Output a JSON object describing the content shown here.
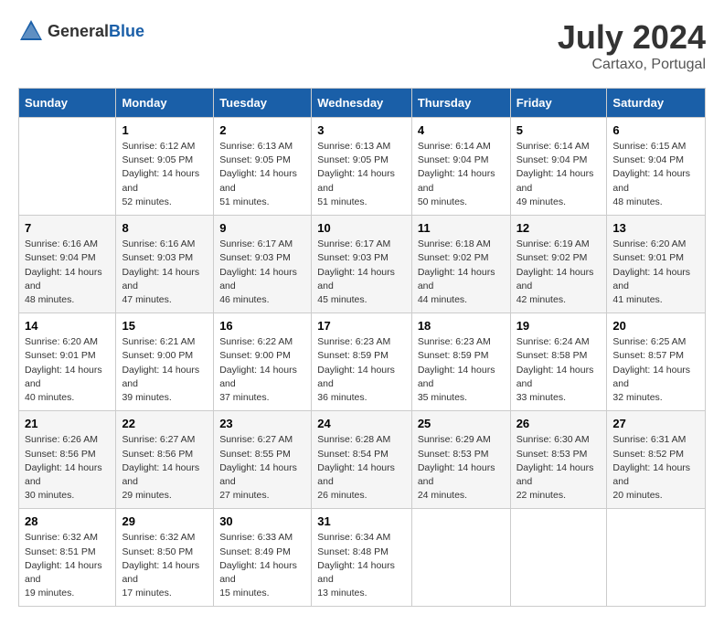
{
  "header": {
    "logo_general": "General",
    "logo_blue": "Blue",
    "month_year": "July 2024",
    "location": "Cartaxo, Portugal"
  },
  "weekdays": [
    "Sunday",
    "Monday",
    "Tuesday",
    "Wednesday",
    "Thursday",
    "Friday",
    "Saturday"
  ],
  "weeks": [
    [
      {
        "day": "",
        "sunrise": "",
        "sunset": "",
        "daylight": ""
      },
      {
        "day": "1",
        "sunrise": "Sunrise: 6:12 AM",
        "sunset": "Sunset: 9:05 PM",
        "daylight": "Daylight: 14 hours and 52 minutes."
      },
      {
        "day": "2",
        "sunrise": "Sunrise: 6:13 AM",
        "sunset": "Sunset: 9:05 PM",
        "daylight": "Daylight: 14 hours and 51 minutes."
      },
      {
        "day": "3",
        "sunrise": "Sunrise: 6:13 AM",
        "sunset": "Sunset: 9:05 PM",
        "daylight": "Daylight: 14 hours and 51 minutes."
      },
      {
        "day": "4",
        "sunrise": "Sunrise: 6:14 AM",
        "sunset": "Sunset: 9:04 PM",
        "daylight": "Daylight: 14 hours and 50 minutes."
      },
      {
        "day": "5",
        "sunrise": "Sunrise: 6:14 AM",
        "sunset": "Sunset: 9:04 PM",
        "daylight": "Daylight: 14 hours and 49 minutes."
      },
      {
        "day": "6",
        "sunrise": "Sunrise: 6:15 AM",
        "sunset": "Sunset: 9:04 PM",
        "daylight": "Daylight: 14 hours and 48 minutes."
      }
    ],
    [
      {
        "day": "7",
        "sunrise": "Sunrise: 6:16 AM",
        "sunset": "Sunset: 9:04 PM",
        "daylight": "Daylight: 14 hours and 48 minutes."
      },
      {
        "day": "8",
        "sunrise": "Sunrise: 6:16 AM",
        "sunset": "Sunset: 9:03 PM",
        "daylight": "Daylight: 14 hours and 47 minutes."
      },
      {
        "day": "9",
        "sunrise": "Sunrise: 6:17 AM",
        "sunset": "Sunset: 9:03 PM",
        "daylight": "Daylight: 14 hours and 46 minutes."
      },
      {
        "day": "10",
        "sunrise": "Sunrise: 6:17 AM",
        "sunset": "Sunset: 9:03 PM",
        "daylight": "Daylight: 14 hours and 45 minutes."
      },
      {
        "day": "11",
        "sunrise": "Sunrise: 6:18 AM",
        "sunset": "Sunset: 9:02 PM",
        "daylight": "Daylight: 14 hours and 44 minutes."
      },
      {
        "day": "12",
        "sunrise": "Sunrise: 6:19 AM",
        "sunset": "Sunset: 9:02 PM",
        "daylight": "Daylight: 14 hours and 42 minutes."
      },
      {
        "day": "13",
        "sunrise": "Sunrise: 6:20 AM",
        "sunset": "Sunset: 9:01 PM",
        "daylight": "Daylight: 14 hours and 41 minutes."
      }
    ],
    [
      {
        "day": "14",
        "sunrise": "Sunrise: 6:20 AM",
        "sunset": "Sunset: 9:01 PM",
        "daylight": "Daylight: 14 hours and 40 minutes."
      },
      {
        "day": "15",
        "sunrise": "Sunrise: 6:21 AM",
        "sunset": "Sunset: 9:00 PM",
        "daylight": "Daylight: 14 hours and 39 minutes."
      },
      {
        "day": "16",
        "sunrise": "Sunrise: 6:22 AM",
        "sunset": "Sunset: 9:00 PM",
        "daylight": "Daylight: 14 hours and 37 minutes."
      },
      {
        "day": "17",
        "sunrise": "Sunrise: 6:23 AM",
        "sunset": "Sunset: 8:59 PM",
        "daylight": "Daylight: 14 hours and 36 minutes."
      },
      {
        "day": "18",
        "sunrise": "Sunrise: 6:23 AM",
        "sunset": "Sunset: 8:59 PM",
        "daylight": "Daylight: 14 hours and 35 minutes."
      },
      {
        "day": "19",
        "sunrise": "Sunrise: 6:24 AM",
        "sunset": "Sunset: 8:58 PM",
        "daylight": "Daylight: 14 hours and 33 minutes."
      },
      {
        "day": "20",
        "sunrise": "Sunrise: 6:25 AM",
        "sunset": "Sunset: 8:57 PM",
        "daylight": "Daylight: 14 hours and 32 minutes."
      }
    ],
    [
      {
        "day": "21",
        "sunrise": "Sunrise: 6:26 AM",
        "sunset": "Sunset: 8:56 PM",
        "daylight": "Daylight: 14 hours and 30 minutes."
      },
      {
        "day": "22",
        "sunrise": "Sunrise: 6:27 AM",
        "sunset": "Sunset: 8:56 PM",
        "daylight": "Daylight: 14 hours and 29 minutes."
      },
      {
        "day": "23",
        "sunrise": "Sunrise: 6:27 AM",
        "sunset": "Sunset: 8:55 PM",
        "daylight": "Daylight: 14 hours and 27 minutes."
      },
      {
        "day": "24",
        "sunrise": "Sunrise: 6:28 AM",
        "sunset": "Sunset: 8:54 PM",
        "daylight": "Daylight: 14 hours and 26 minutes."
      },
      {
        "day": "25",
        "sunrise": "Sunrise: 6:29 AM",
        "sunset": "Sunset: 8:53 PM",
        "daylight": "Daylight: 14 hours and 24 minutes."
      },
      {
        "day": "26",
        "sunrise": "Sunrise: 6:30 AM",
        "sunset": "Sunset: 8:53 PM",
        "daylight": "Daylight: 14 hours and 22 minutes."
      },
      {
        "day": "27",
        "sunrise": "Sunrise: 6:31 AM",
        "sunset": "Sunset: 8:52 PM",
        "daylight": "Daylight: 14 hours and 20 minutes."
      }
    ],
    [
      {
        "day": "28",
        "sunrise": "Sunrise: 6:32 AM",
        "sunset": "Sunset: 8:51 PM",
        "daylight": "Daylight: 14 hours and 19 minutes."
      },
      {
        "day": "29",
        "sunrise": "Sunrise: 6:32 AM",
        "sunset": "Sunset: 8:50 PM",
        "daylight": "Daylight: 14 hours and 17 minutes."
      },
      {
        "day": "30",
        "sunrise": "Sunrise: 6:33 AM",
        "sunset": "Sunset: 8:49 PM",
        "daylight": "Daylight: 14 hours and 15 minutes."
      },
      {
        "day": "31",
        "sunrise": "Sunrise: 6:34 AM",
        "sunset": "Sunset: 8:48 PM",
        "daylight": "Daylight: 14 hours and 13 minutes."
      },
      {
        "day": "",
        "sunrise": "",
        "sunset": "",
        "daylight": ""
      },
      {
        "day": "",
        "sunrise": "",
        "sunset": "",
        "daylight": ""
      },
      {
        "day": "",
        "sunrise": "",
        "sunset": "",
        "daylight": ""
      }
    ]
  ]
}
